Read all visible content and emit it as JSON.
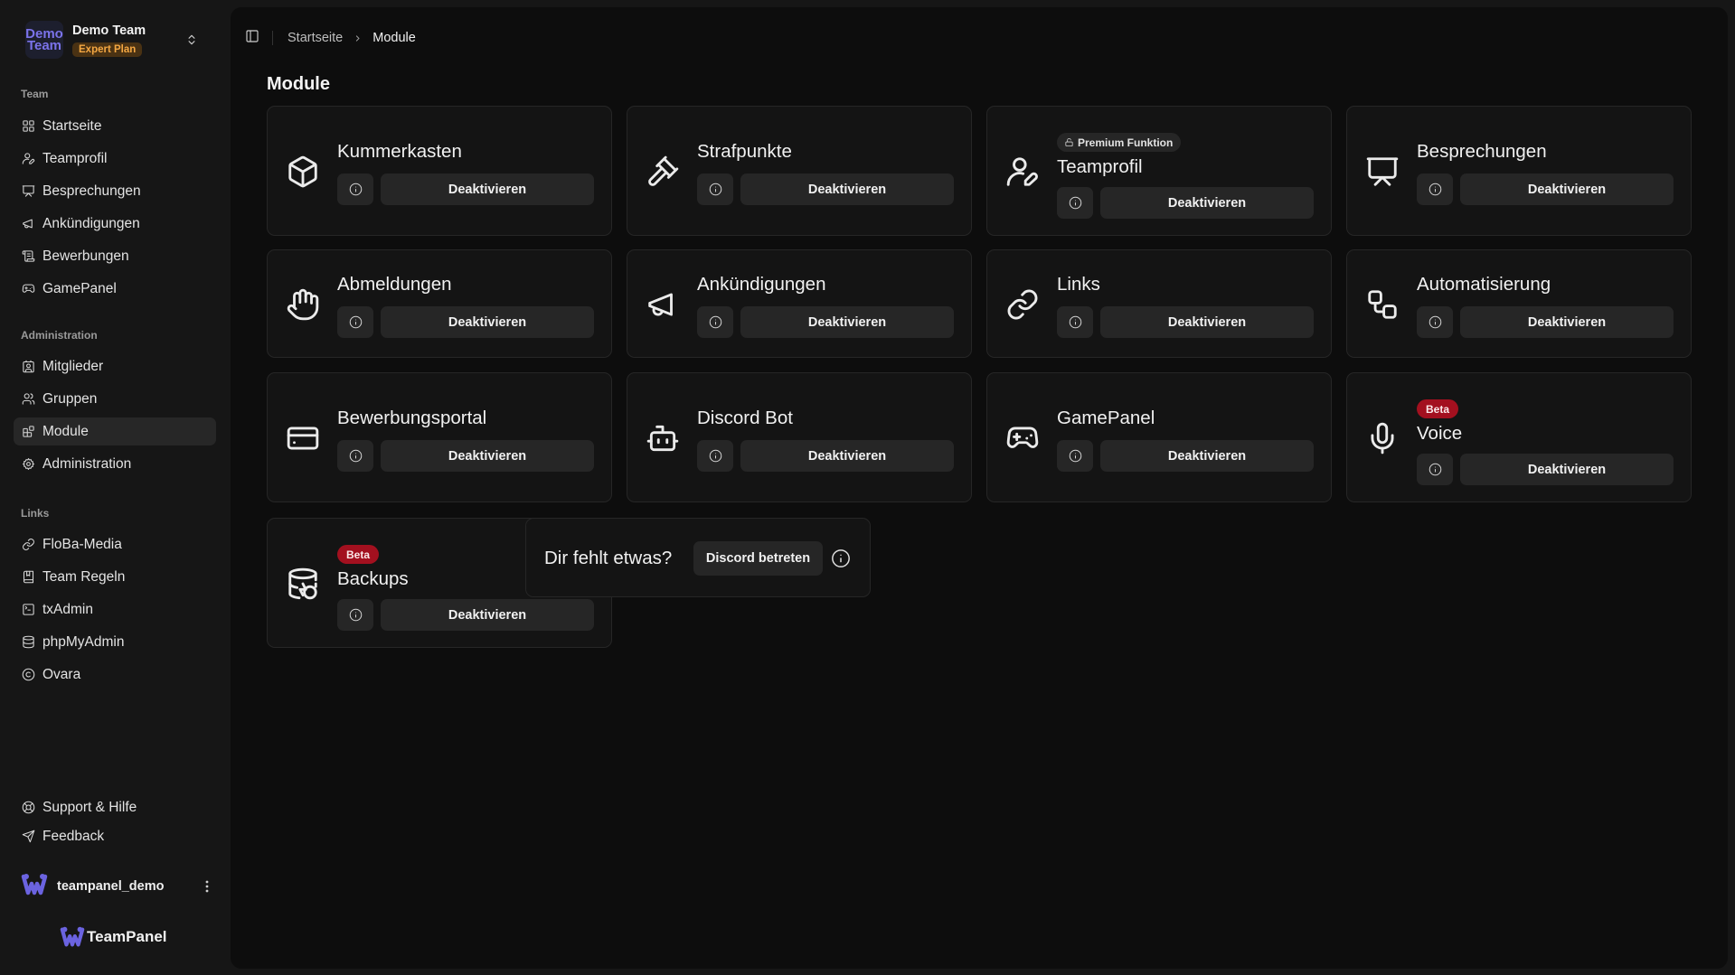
{
  "team": {
    "logo_line1": "Demo",
    "logo_line2": "Team",
    "name": "Demo Team",
    "plan": "Expert Plan"
  },
  "sidebar": {
    "sections": [
      {
        "label": "Team",
        "items": [
          {
            "label": "Startseite",
            "icon": "layout-grid-icon"
          },
          {
            "label": "Teamprofil",
            "icon": "user-pen-icon"
          },
          {
            "label": "Besprechungen",
            "icon": "presentation-icon"
          },
          {
            "label": "Ankündigungen",
            "icon": "megaphone-icon"
          },
          {
            "label": "Bewerbungen",
            "icon": "scroll-icon"
          },
          {
            "label": "GamePanel",
            "icon": "gamepad-icon"
          }
        ]
      },
      {
        "label": "Administration",
        "items": [
          {
            "label": "Mitglieder",
            "icon": "contact-icon"
          },
          {
            "label": "Gruppen",
            "icon": "users-icon"
          },
          {
            "label": "Module",
            "icon": "blocks-icon",
            "active": true
          },
          {
            "label": "Administration",
            "icon": "gear-icon"
          }
        ]
      },
      {
        "label": "Links",
        "items": [
          {
            "label": "FloBa-Media",
            "icon": "link-icon"
          },
          {
            "label": "Team Regeln",
            "icon": "book-icon"
          },
          {
            "label": "txAdmin",
            "icon": "terminal-icon"
          },
          {
            "label": "phpMyAdmin",
            "icon": "database-icon"
          },
          {
            "label": "Ovara",
            "icon": "copyright-icon"
          }
        ]
      }
    ],
    "footer_items": [
      {
        "label": "Support & Hilfe",
        "icon": "lifebuoy-icon"
      },
      {
        "label": "Feedback",
        "icon": "send-icon"
      }
    ],
    "user": {
      "name": "teampanel_demo"
    },
    "brand": "TeamPanel"
  },
  "breadcrumb": {
    "home": "Startseite",
    "current": "Module"
  },
  "page_title": "Module",
  "modules": [
    {
      "title": "Kummerkasten",
      "icon": "box-icon",
      "action": "Deaktivieren"
    },
    {
      "title": "Strafpunkte",
      "icon": "gavel-icon",
      "action": "Deaktivieren"
    },
    {
      "title": "Teamprofil",
      "icon": "user-pen-icon",
      "action": "Deaktivieren",
      "badge": "Premium Funktion",
      "badge_type": "premium"
    },
    {
      "title": "Besprechungen",
      "icon": "presentation-icon",
      "action": "Deaktivieren"
    },
    {
      "title": "Abmeldungen",
      "icon": "hand-icon",
      "action": "Deaktivieren"
    },
    {
      "title": "Ankündigungen",
      "icon": "megaphone-icon",
      "action": "Deaktivieren"
    },
    {
      "title": "Links",
      "icon": "link-icon",
      "action": "Deaktivieren"
    },
    {
      "title": "Automatisierung",
      "icon": "workflow-icon",
      "action": "Deaktivieren"
    },
    {
      "title": "Bewerbungsportal",
      "icon": "credit-card-icon",
      "action": "Deaktivieren"
    },
    {
      "title": "Discord Bot",
      "icon": "bot-icon",
      "action": "Deaktivieren"
    },
    {
      "title": "GamePanel",
      "icon": "gamepad-icon",
      "action": "Deaktivieren"
    },
    {
      "title": "Voice",
      "icon": "mic-icon",
      "action": "Deaktivieren",
      "badge": "Beta",
      "badge_type": "beta"
    },
    {
      "title": "Backups",
      "icon": "database-backup-icon",
      "action": "Deaktivieren",
      "badge": "Beta",
      "badge_type": "beta"
    }
  ],
  "missing": {
    "text": "Dir fehlt etwas?",
    "button": "Discord betreten"
  },
  "colors": {
    "background": "#161616",
    "main_panel": "#0d0d0d",
    "card": "#141414",
    "button": "#262626",
    "beta_badge": "#a3101f",
    "plan_badge_text": "#f4a742",
    "brand_purple": "#7b73ea"
  }
}
